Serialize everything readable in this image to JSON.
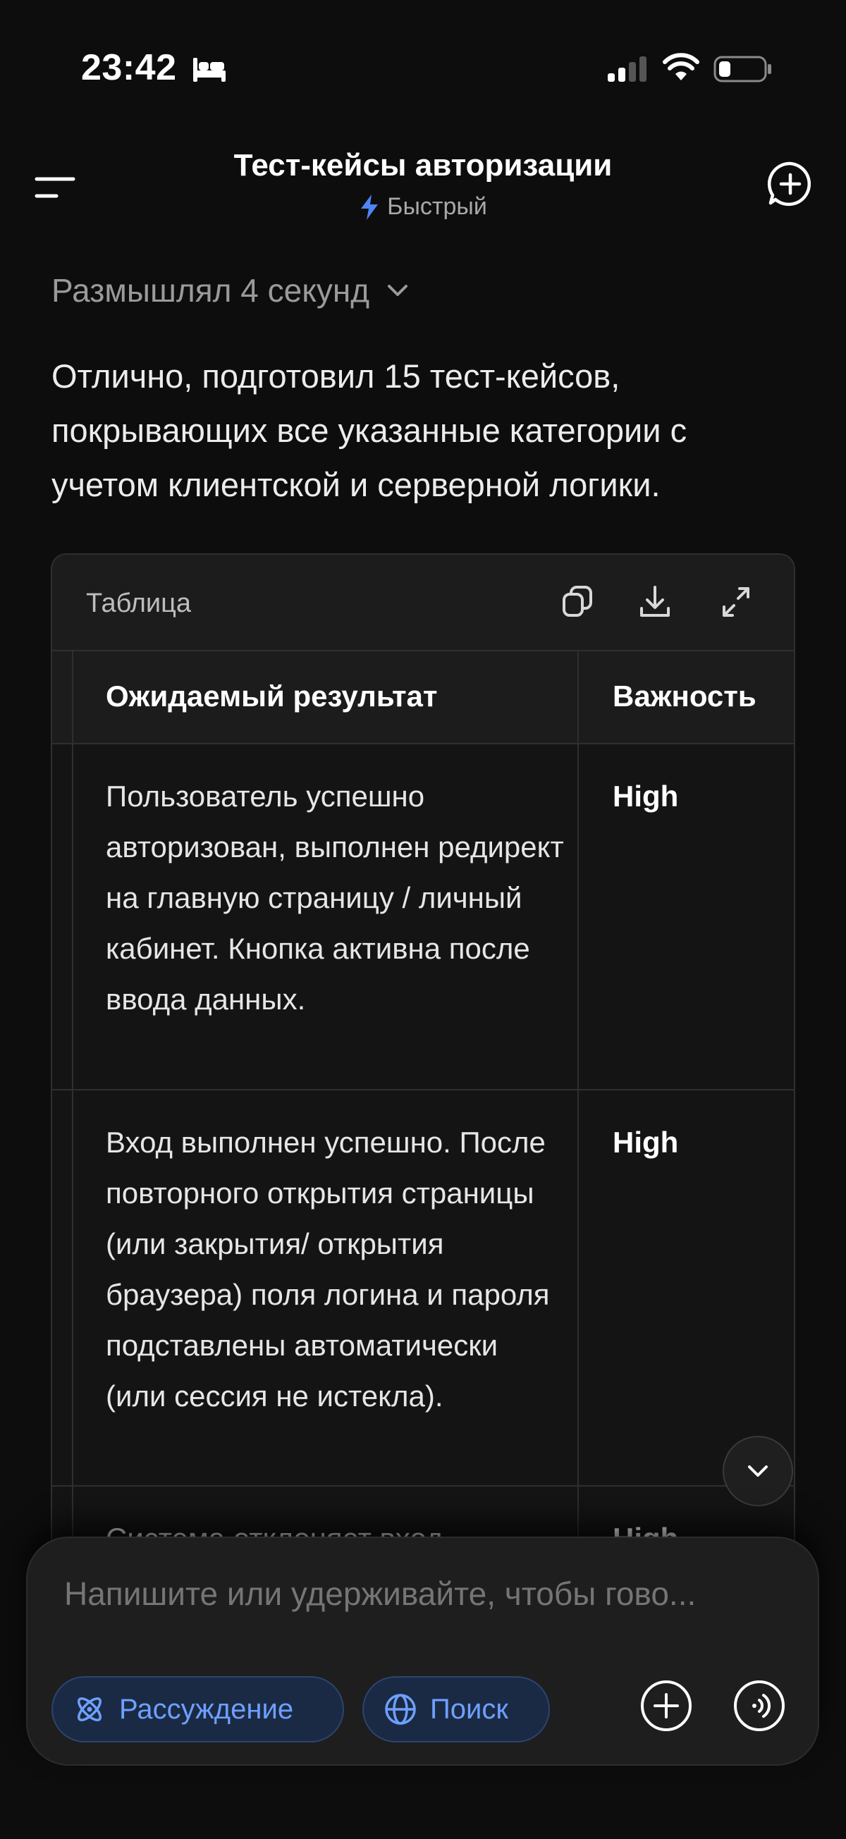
{
  "status_bar": {
    "time": "23:42"
  },
  "header": {
    "title": "Тест-кейсы авторизации",
    "model": "Быстрый"
  },
  "thinking": {
    "label": "Размышлял 4 секунд"
  },
  "answer": {
    "text": "Отлично, подготовил 15 тест-кейсов, покрывающих все указанные категории с учетом клиентской и серверной логики."
  },
  "table": {
    "label": "Таблица",
    "columns": [
      "Ожидаемый результат",
      "Важность"
    ],
    "rows": [
      {
        "result": "Пользователь успешно авторизован, выполнен редирект на главную страницу / личный кабинет. Кнопка активна после ввода данных.",
        "importance": "High"
      },
      {
        "result": "Вход выполнен успешно. После повторного открытия страницы (или закрытия/ открытия браузера) поля логина и пароля подставлены автоматически (или сессия не истекла).",
        "importance": "High"
      },
      {
        "result": "Система отклоняет вход",
        "importance": "High"
      }
    ]
  },
  "composer": {
    "placeholder": "Напишите или удерживайте, чтобы гово...",
    "reasoning_label": "Рассуждение",
    "search_label": "Поиск"
  },
  "colors": {
    "background": "#0d0d0d",
    "accent": "#6ea0ff",
    "pill_bg": "#1b2a44"
  },
  "icons": [
    "bed-icon",
    "signal-icon",
    "wifi-icon",
    "battery-icon",
    "menu-icon",
    "bolt-icon",
    "new-chat-icon",
    "chevron-down-icon",
    "copy-icon",
    "download-icon",
    "expand-icon",
    "atom-icon",
    "globe-icon",
    "plus-icon",
    "voice-icon"
  ]
}
